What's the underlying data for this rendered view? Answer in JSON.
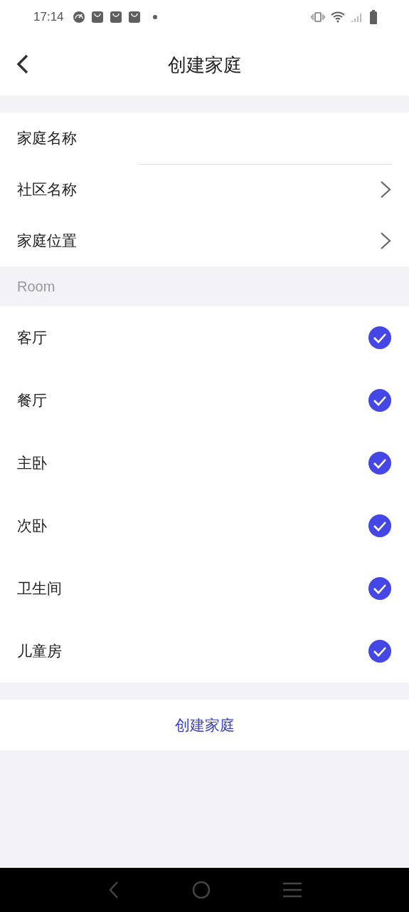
{
  "status_bar": {
    "time": "17:14"
  },
  "header": {
    "title": "创建家庭"
  },
  "form": [
    {
      "kind": "field",
      "label": "家庭名称"
    },
    {
      "kind": "link",
      "label": "社区名称"
    },
    {
      "kind": "link",
      "label": "家庭位置"
    }
  ],
  "room_section": {
    "title": "Room"
  },
  "rooms": [
    {
      "name": "客厅",
      "checked": true
    },
    {
      "name": "餐厅",
      "checked": true
    },
    {
      "name": "主卧",
      "checked": true
    },
    {
      "name": "次卧",
      "checked": true
    },
    {
      "name": "卫生间",
      "checked": true
    },
    {
      "name": "儿童房",
      "checked": true
    }
  ],
  "create_button": {
    "label": "创建家庭"
  }
}
